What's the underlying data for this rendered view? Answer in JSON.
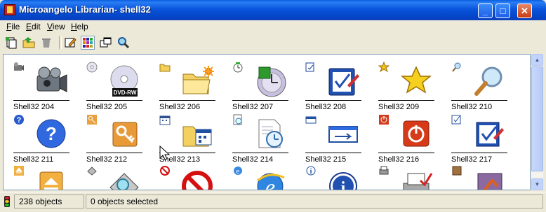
{
  "window": {
    "title": "Microangelo Librarian- shell32",
    "minimize": "_",
    "maximize": "□",
    "close": "✕"
  },
  "menu": [
    {
      "key": "F",
      "rest": "ile"
    },
    {
      "key": "E",
      "rest": "dit"
    },
    {
      "key": "V",
      "rest": "iew"
    },
    {
      "key": "H",
      "rest": "elp"
    }
  ],
  "toolbar": [
    "new-document-icon",
    "open-folder-icon",
    "recycle-icon",
    "edit-icon",
    "view-icons-icon",
    "windows-icon",
    "search-icon"
  ],
  "icons": [
    {
      "label": "Shell32 204",
      "icon": "camcorder-icon"
    },
    {
      "label": "Shell32 205",
      "icon": "dvd-rw-icon"
    },
    {
      "label": "Shell32 206",
      "icon": "new-folder-icon"
    },
    {
      "label": "Shell32 207",
      "icon": "disc-clock-icon"
    },
    {
      "label": "Shell32 208",
      "icon": "checklist-icon"
    },
    {
      "label": "Shell32 209",
      "icon": "star-icon"
    },
    {
      "label": "Shell32 210",
      "icon": "magnifier-icon"
    },
    {
      "label": "Shell32 211",
      "icon": "help-icon"
    },
    {
      "label": "Shell32 212",
      "icon": "key-icon"
    },
    {
      "label": "Shell32 213",
      "icon": "folder-calendar-icon"
    },
    {
      "label": "Shell32 214",
      "icon": "document-clock-icon"
    },
    {
      "label": "Shell32 215",
      "icon": "window-arrow-icon"
    },
    {
      "label": "Shell32 216",
      "icon": "power-icon"
    },
    {
      "label": "Shell32 217",
      "icon": "checkbox-icon"
    },
    {
      "label": "",
      "icon": "eject-icon"
    },
    {
      "label": "",
      "icon": "scanner-icon"
    },
    {
      "label": "",
      "icon": "stop-icon"
    },
    {
      "label": "",
      "icon": "internet-explorer-icon"
    },
    {
      "label": "",
      "icon": "info-icon"
    },
    {
      "label": "",
      "icon": "printer-check-icon"
    },
    {
      "label": "",
      "icon": "program-icon"
    }
  ],
  "status": {
    "objects": "238 objects",
    "selected": "0 objects selected"
  },
  "colors": {
    "title_bar": "#0a5fe0",
    "window_face": "#ece9d8",
    "close_button": "#c83b10"
  }
}
